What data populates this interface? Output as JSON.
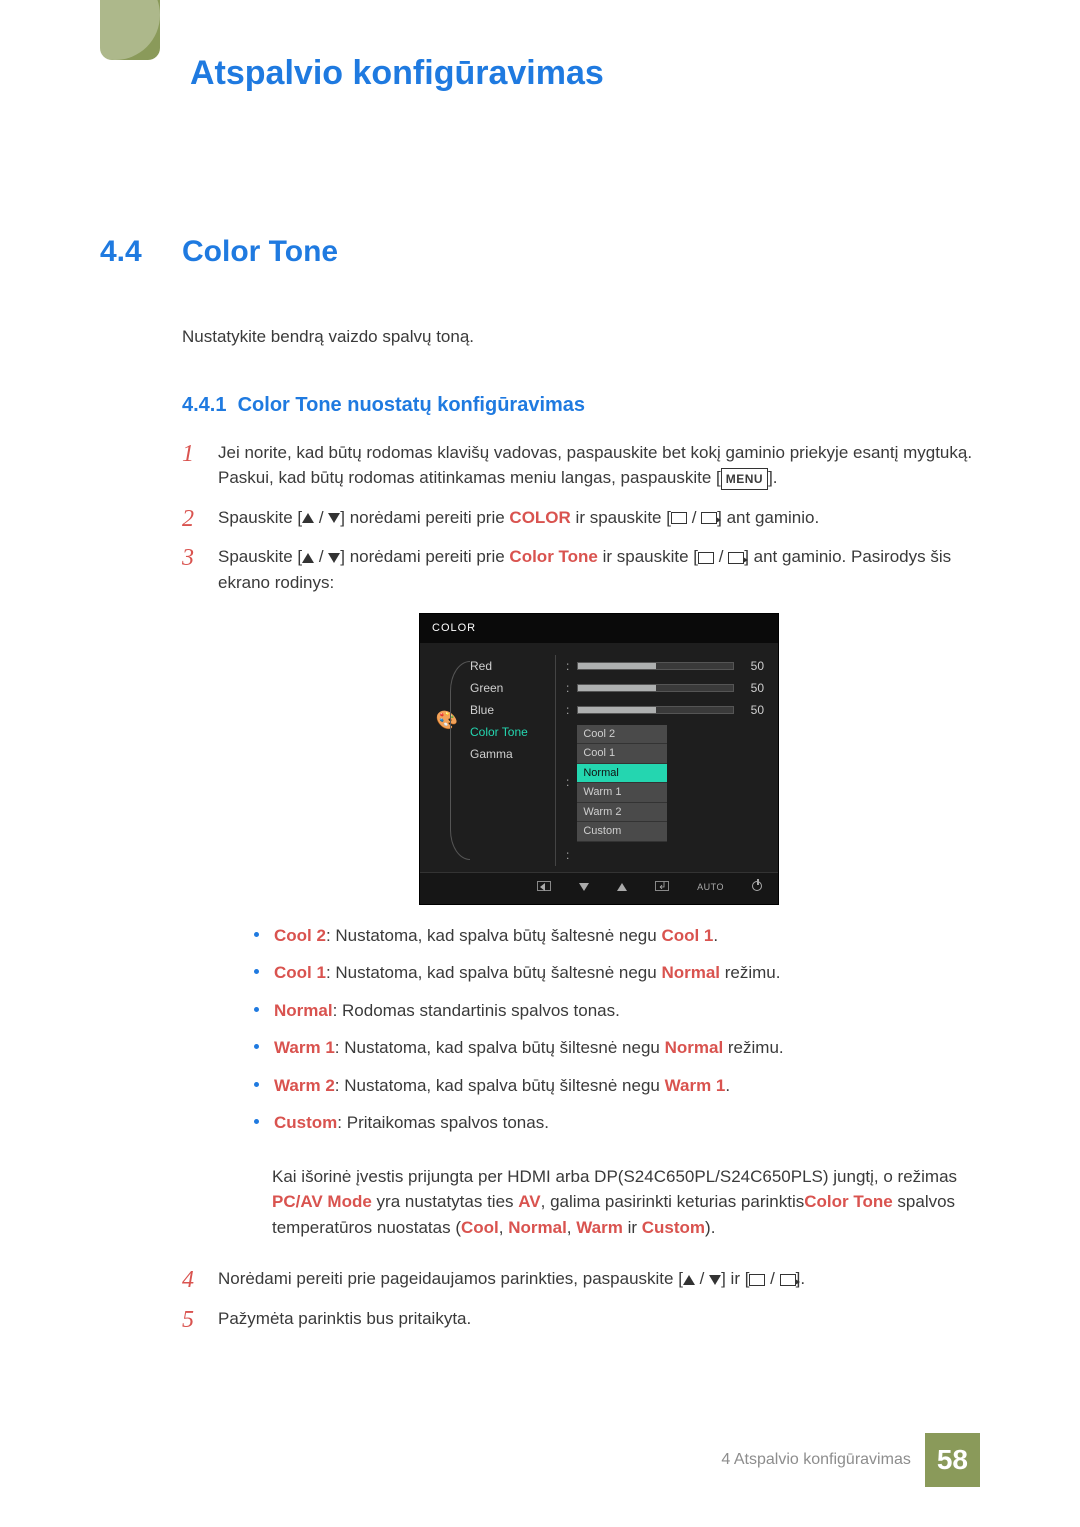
{
  "chapter": {
    "title": "Atspalvio konfigūravimas"
  },
  "section": {
    "number": "4.4",
    "title": "Color Tone"
  },
  "intro": "Nustatykite bendrą vaizdo spalvų toną.",
  "subsection": {
    "number": "4.4.1",
    "title": "Color Tone nuostatų konfigūravimas"
  },
  "steps": {
    "s1a": "Jei norite, kad būtų rodomas klavišų vadovas, paspauskite bet kokį gaminio priekyje esantį mygtuką. Paskui, kad būtų rodomas atitinkamas meniu langas, paspauskite [",
    "s1b": "].",
    "menu_label": "MENU",
    "s2a": "Spauskite [",
    "s2b": "] norėdami pereiti prie ",
    "s2_color": "COLOR",
    "s2c": " ir spauskite [",
    "s2d": "] ant gaminio.",
    "s3a": "Spauskite [",
    "s3b": "] norėdami pereiti prie ",
    "s3_ct": "Color Tone",
    "s3c": " ir spauskite [",
    "s3d": "] ant gaminio. Pasirodys šis ekrano rodinys:",
    "s4a": "Norėdami pereiti prie pageidaujamos parinkties, paspauskite [",
    "s4b": "] ir [",
    "s4c": "].",
    "s5": "Pažymėta parinktis bus pritaikyta."
  },
  "osd": {
    "header": "COLOR",
    "left": [
      "Red",
      "Green",
      "Blue",
      "Color Tone",
      "Gamma"
    ],
    "rgb_val": "50",
    "options": [
      "Cool 2",
      "Cool 1",
      "Normal",
      "Warm 1",
      "Warm 2",
      "Custom"
    ],
    "footer_auto": "AUTO"
  },
  "tone": {
    "cool2_k": "Cool 2",
    "cool2_t": ": Nustatoma, kad spalva būtų šaltesnė negu ",
    "cool2_r": "Cool 1",
    "cool2_e": ".",
    "cool1_k": "Cool 1",
    "cool1_t": ": Nustatoma, kad spalva būtų šaltesnė negu ",
    "cool1_r": "Normal",
    "cool1_e": " režimu.",
    "normal_k": "Normal",
    "normal_t": ": Rodomas standartinis spalvos tonas.",
    "warm1_k": "Warm 1",
    "warm1_t": ": Nustatoma, kad spalva būtų šiltesnė negu ",
    "warm1_r": "Normal",
    "warm1_e": " režimu.",
    "warm2_k": "Warm 2",
    "warm2_t": ": Nustatoma, kad spalva būtų šiltesnė negu ",
    "warm2_r": "Warm 1",
    "warm2_e": ".",
    "custom_k": "Custom",
    "custom_t": ": Pritaikomas spalvos tonas."
  },
  "note": {
    "a": "Kai išorinė įvestis prijungta per HDMI arba DP(S24C650PL/S24C650PLS) jungtį, o režimas ",
    "pcav": "PC/AV Mode",
    "b": " yra nustatytas ties ",
    "av": "AV",
    "c": ", galima pasirinkti keturias parinktis",
    "ct": "Color Tone",
    "d": " spalvos temperatūros nuostatas (",
    "cool": "Cool",
    "sep1": ", ",
    "normal": "Normal",
    "sep2": ", ",
    "warm": "Warm",
    "sep3": " ir ",
    "custom": "Custom",
    "e": ")."
  },
  "footer": {
    "text": "4 Atspalvio konfigūravimas",
    "page": "58"
  }
}
